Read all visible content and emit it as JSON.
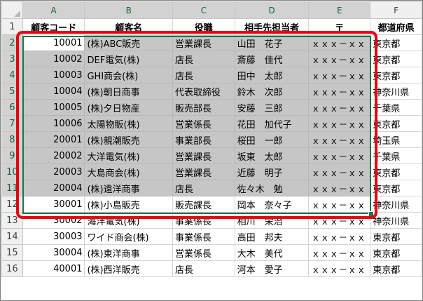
{
  "columns": [
    "A",
    "B",
    "C",
    "D",
    "E",
    "F"
  ],
  "header_row": [
    "顧客コード",
    "顧客名",
    "役職",
    "相手先担当者",
    "〒",
    "都道府県"
  ],
  "rows": [
    {
      "num": "2",
      "cells": [
        "10001",
        "(株)ABC販売",
        "営業課長",
        "山田　花子",
        "ｘｘｘ－ｘｘ",
        "東京都"
      ]
    },
    {
      "num": "3",
      "cells": [
        "10002",
        "DEF電気(株)",
        "店長",
        "斎藤　佳代",
        "ｘｘｘ－ｘｘ",
        "東京都"
      ]
    },
    {
      "num": "4",
      "cells": [
        "10003",
        "GHI商会(株)",
        "店長",
        "田中　太郎",
        "ｘｘｘ－ｘｘ",
        "東京都"
      ]
    },
    {
      "num": "5",
      "cells": [
        "10004",
        "(株)朝日商事",
        "代表取締役",
        "鈴木　次郎",
        "ｘｘｘ－ｘｘ",
        "神奈川県"
      ]
    },
    {
      "num": "6",
      "cells": [
        "10005",
        "(株)夕日物産",
        "販売部長",
        "安藤　三郎",
        "ｘｘｘ－ｘｘ",
        "千葉県"
      ]
    },
    {
      "num": "7",
      "cells": [
        "10006",
        "太陽物販(株)",
        "営業係長",
        "花田　加代子",
        "ｘｘｘ－ｘｘ",
        "東京都"
      ]
    },
    {
      "num": "8",
      "cells": [
        "20001",
        "(株)親潮販売",
        "事業部長",
        "桜田　一郎",
        "ｘｘｘ－ｘｘ",
        "埼玉県"
      ]
    },
    {
      "num": "9",
      "cells": [
        "20002",
        "大洋電気(株)",
        "営業課長",
        "坂東　太郎",
        "ｘｘｘ－ｘｘ",
        "千葉県"
      ]
    },
    {
      "num": "10",
      "cells": [
        "20003",
        "大島商会(株)",
        "営業課長",
        "近藤　明子",
        "ｘｘｘ－ｘｘ",
        "東京都"
      ]
    },
    {
      "num": "11",
      "cells": [
        "20004",
        "(株)遠洋商事",
        "店長",
        "佐々木　勉",
        "ｘｘｘ－ｘｘ",
        "東京都"
      ]
    },
    {
      "num": "12",
      "cells": [
        "30001",
        "(株)小島販売",
        "販売課長",
        "岡本　奈々子",
        "ｘｘｘ－ｘｘ",
        "神奈川県"
      ]
    },
    {
      "num": "13",
      "cells": [
        "30002",
        "海洋電気(株)",
        "事業係長",
        "相川　栄治",
        "ｘｘｘ－ｘｘ",
        "神奈川県"
      ]
    },
    {
      "num": "14",
      "cells": [
        "30003",
        "ワイド商会(株)",
        "事業係長",
        "高田　邦夫",
        "ｘｘｘ－ｘｘ",
        "東京都"
      ]
    },
    {
      "num": "15",
      "cells": [
        "30004",
        "(株)東洋商事",
        "営業係長",
        "大木　美代",
        "ｘｘｘ－ｘｘ",
        "東京都"
      ]
    },
    {
      "num": "16",
      "cells": [
        "40001",
        "(株)西洋販売",
        "店長",
        "河本　愛子",
        "ｘｘｘ－ｘｘ",
        "東京都"
      ]
    }
  ]
}
